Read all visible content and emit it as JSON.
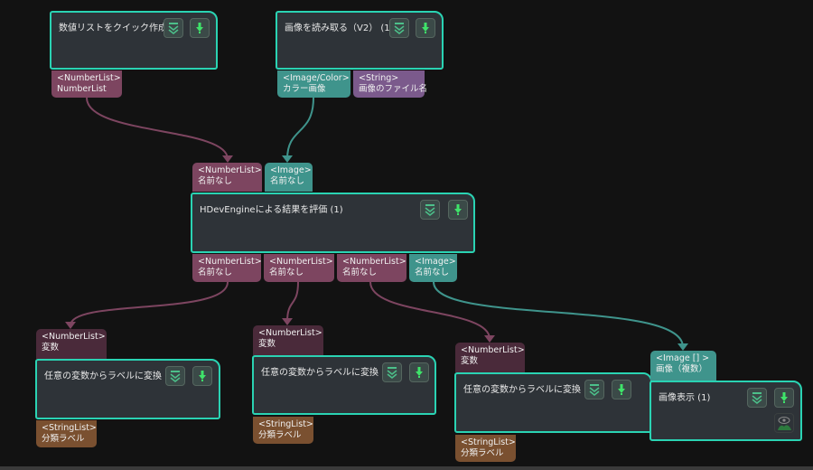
{
  "colors": {
    "node_border": "#2ad3b3",
    "number_list": "#7d4560",
    "image": "#3f948c",
    "string": "#7b5a8c",
    "string_list": "#7a5030",
    "input_dark": "#4a2a3a"
  },
  "nodes": [
    {
      "title": "数値リストをクイック作成 (1)",
      "outputs": [
        {
          "type": "<NumberList>",
          "name": "NumberList"
        }
      ]
    },
    {
      "title": "画像を読み取る（V2） (1)",
      "outputs": [
        {
          "type": "<Image/Color>",
          "name": "カラー画像"
        },
        {
          "type": "<String>",
          "name": "画像のファイル名"
        }
      ]
    },
    {
      "title": "HDevEngineによる結果を評価 (1)",
      "inputs": [
        {
          "type": "<NumberList>",
          "name": "名前なし"
        },
        {
          "type": "<Image>",
          "name": "名前なし"
        }
      ],
      "outputs": [
        {
          "type": "<NumberList>",
          "name": "名前なし"
        },
        {
          "type": "<NumberList>",
          "name": "名前なし"
        },
        {
          "type": "<NumberList>",
          "name": "名前なし"
        },
        {
          "type": "<Image>",
          "name": "名前なし"
        }
      ]
    },
    {
      "title": "任意の変数からラベルに変換 (1)",
      "inputs": [
        {
          "type": "<NumberList>",
          "name": "変数"
        }
      ],
      "outputs": [
        {
          "type": "<StringList>",
          "name": "分類ラベル"
        }
      ]
    },
    {
      "title": "任意の変数からラベルに変換 (2)",
      "inputs": [
        {
          "type": "<NumberList>",
          "name": "変数"
        }
      ],
      "outputs": [
        {
          "type": "<StringList>",
          "name": "分類ラベル"
        }
      ]
    },
    {
      "title": "任意の変数からラベルに変換 (3)",
      "inputs": [
        {
          "type": "<NumberList>",
          "name": "変数"
        }
      ],
      "outputs": [
        {
          "type": "<StringList>",
          "name": "分類ラベル"
        }
      ]
    },
    {
      "title": "画像表示 (1)",
      "inputs": [
        {
          "type": "<Image [] >",
          "name": "画像（複数）"
        }
      ]
    }
  ],
  "icons": {
    "collapse": "chevron-double-down-icon",
    "run": "pin-down-icon",
    "visibility": "eye-icon"
  }
}
